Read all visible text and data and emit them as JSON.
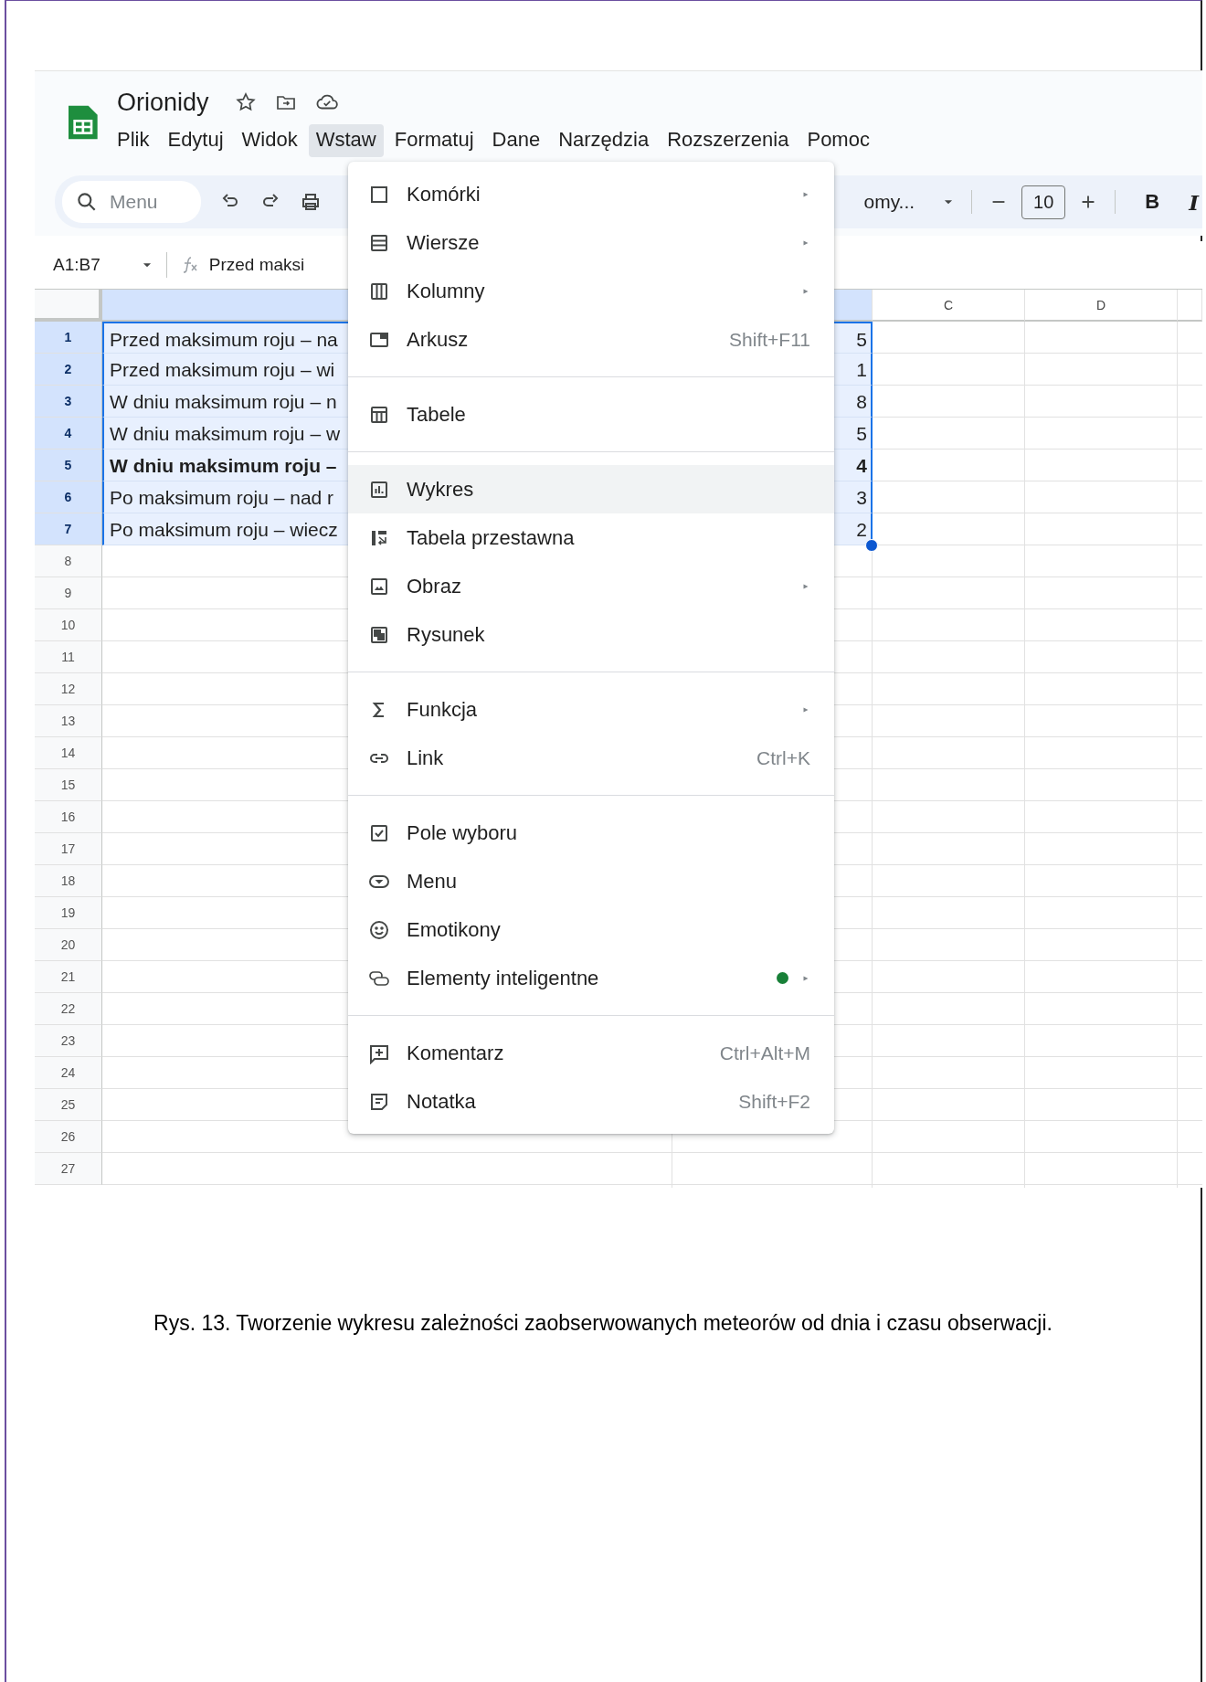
{
  "app": {
    "title": "Orionidy",
    "menubar": [
      {
        "label": "Plik",
        "selected": false
      },
      {
        "label": "Edytuj",
        "selected": false
      },
      {
        "label": "Widok",
        "selected": false
      },
      {
        "label": "Wstaw",
        "selected": true
      },
      {
        "label": "Formatuj",
        "selected": false
      },
      {
        "label": "Dane",
        "selected": false
      },
      {
        "label": "Narzędzia",
        "selected": false
      },
      {
        "label": "Rozszerzenia",
        "selected": false
      },
      {
        "label": "Pomoc",
        "selected": false
      }
    ],
    "toolbar": {
      "search_placeholder": "Menu",
      "font": "omy...",
      "font_size": "10",
      "bold": "B",
      "italic": "I"
    },
    "formula_bar": {
      "name_box": "A1:B7",
      "content": "Przed maksi"
    },
    "column_headers": [
      {
        "selected": true
      },
      {
        "selected": true
      },
      {
        "label": "C",
        "selected": false
      },
      {
        "label": "D",
        "selected": false
      }
    ],
    "rows": [
      {
        "number": "1",
        "selected": true,
        "a": "Przed maksimum roju – na",
        "b": "5",
        "bold": false
      },
      {
        "number": "2",
        "selected": true,
        "a": "Przed maksimum roju – wi",
        "b": "1",
        "bold": false
      },
      {
        "number": "3",
        "selected": true,
        "a": "W dniu maksimum roju – n",
        "b": "8",
        "bold": false
      },
      {
        "number": "4",
        "selected": true,
        "a": "W dniu maksimum roju – w",
        "b": "5",
        "bold": false
      },
      {
        "number": "5",
        "selected": true,
        "a": "W dniu maksimum roju –",
        "b": "4",
        "bold": true
      },
      {
        "number": "6",
        "selected": true,
        "a": "Po maksimum roju – nad r",
        "b": "3",
        "bold": false
      },
      {
        "number": "7",
        "selected": true,
        "a": "Po maksimum roju – wiecz",
        "b": "2",
        "bold": false
      },
      {
        "number": "8",
        "selected": false
      },
      {
        "number": "9",
        "selected": false
      },
      {
        "number": "10",
        "selected": false
      },
      {
        "number": "11",
        "selected": false
      },
      {
        "number": "12",
        "selected": false
      },
      {
        "number": "13",
        "selected": false
      },
      {
        "number": "14",
        "selected": false
      },
      {
        "number": "15",
        "selected": false
      },
      {
        "number": "16",
        "selected": false
      },
      {
        "number": "17",
        "selected": false
      },
      {
        "number": "18",
        "selected": false
      },
      {
        "number": "19",
        "selected": false
      },
      {
        "number": "20",
        "selected": false
      },
      {
        "number": "21",
        "selected": false
      },
      {
        "number": "22",
        "selected": false
      },
      {
        "number": "23",
        "selected": false
      },
      {
        "number": "24",
        "selected": false
      },
      {
        "number": "25",
        "selected": false
      },
      {
        "number": "26",
        "selected": false
      },
      {
        "number": "27",
        "selected": false
      }
    ],
    "insert_menu": [
      {
        "kind": "item",
        "label": "Komórki",
        "submenu": true,
        "highlighted": false
      },
      {
        "kind": "item",
        "label": "Wiersze",
        "submenu": true,
        "highlighted": false
      },
      {
        "kind": "item",
        "label": "Kolumny",
        "submenu": true,
        "highlighted": false
      },
      {
        "kind": "item",
        "label": "Arkusz",
        "shortcut": "Shift+F11",
        "submenu": false,
        "highlighted": false
      },
      {
        "kind": "separator"
      },
      {
        "kind": "item",
        "label": "Tabele",
        "submenu": false,
        "highlighted": false
      },
      {
        "kind": "separator"
      },
      {
        "kind": "item",
        "label": "Wykres",
        "submenu": false,
        "highlighted": true
      },
      {
        "kind": "item",
        "label": "Tabela przestawna",
        "submenu": false,
        "highlighted": false
      },
      {
        "kind": "item",
        "label": "Obraz",
        "submenu": true,
        "highlighted": false
      },
      {
        "kind": "item",
        "label": "Rysunek",
        "submenu": false,
        "highlighted": false
      },
      {
        "kind": "separator"
      },
      {
        "kind": "item",
        "label": "Funkcja",
        "submenu": true,
        "highlighted": false
      },
      {
        "kind": "item",
        "label": "Link",
        "shortcut": "Ctrl+K",
        "submenu": false,
        "highlighted": false
      },
      {
        "kind": "separator"
      },
      {
        "kind": "item",
        "label": "Pole wyboru",
        "submenu": false,
        "highlighted": false
      },
      {
        "kind": "item",
        "label": "Menu",
        "submenu": false,
        "highlighted": false
      },
      {
        "kind": "item",
        "label": "Emotikony",
        "submenu": false,
        "highlighted": false
      },
      {
        "kind": "item",
        "label": "Elementy inteligentne",
        "submenu": true,
        "highlighted": false,
        "color": "#188038"
      },
      {
        "kind": "separator"
      },
      {
        "kind": "item",
        "label": "Komentarz",
        "shortcut": "Ctrl+Alt+M",
        "submenu": false,
        "highlighted": false
      },
      {
        "kind": "item",
        "label": "Notatka",
        "shortcut": "Shift+F2",
        "submenu": false,
        "highlighted": false
      }
    ]
  },
  "caption": "Rys. 13. Tworzenie wykresu zależności zaobserwowanych meteorów od dnia i czasu obserwacji."
}
